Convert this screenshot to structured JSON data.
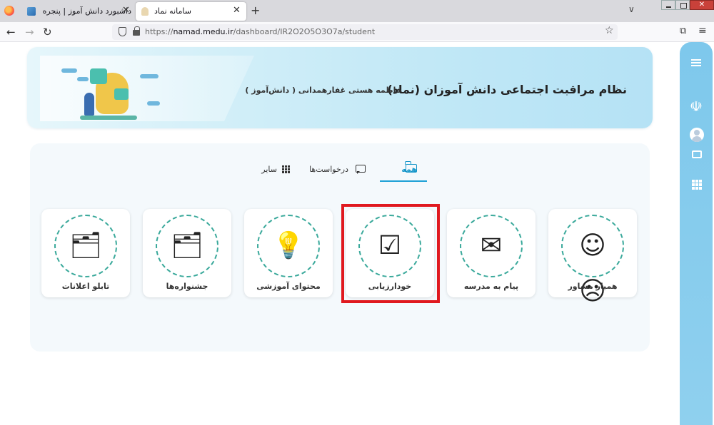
{
  "browser": {
    "tabs": [
      {
        "title": "داشبورد دانش آموز | پنجره واحد خدمات",
        "close": "✕"
      },
      {
        "title": "سامانه نماد",
        "close": "✕"
      }
    ],
    "new_tab": "+",
    "tab_list": "∨",
    "url_domain": "namad.medu.ir",
    "url_prefix": "https://",
    "url_path": "/dashboard/IR2O2O5O3O7a/student",
    "window_close": "✕"
  },
  "banner": {
    "title": "نظام مراقبت اجتماعی دانش آموزان (نماد)",
    "user": "فاطمه هستی غفارهمدانی ( دانش‌آموز )"
  },
  "tabs": [
    {
      "label": "همه",
      "icon": "folder-icon",
      "active": true
    },
    {
      "label": "درخواست‌ها",
      "icon": "chat-icon",
      "active": false
    },
    {
      "label": "سایر",
      "icon": "grid-icon",
      "active": false
    }
  ],
  "cards": [
    {
      "label": "همیار مشاور",
      "icon": "counselor-icon"
    },
    {
      "label": "پیام به مدرسه",
      "icon": "ballot-icon"
    },
    {
      "label": "خودارزیابی",
      "icon": "checklist-icon"
    },
    {
      "label": "محتوای آموزشی",
      "icon": "bulb-book-icon"
    },
    {
      "label": "جشنواره‌ها",
      "icon": "folders-icon"
    },
    {
      "label": "تابلو اعلانات",
      "icon": "folders-icon"
    }
  ],
  "colors": {
    "accent": "#1596c9",
    "ring": "#3aa99b",
    "highlight": "#e0191f",
    "rail": "#8fd0ee"
  }
}
